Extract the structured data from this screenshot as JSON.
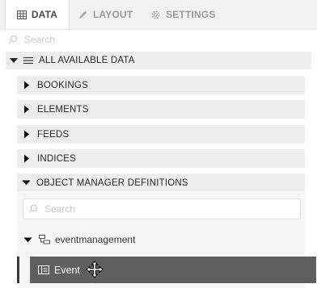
{
  "tabs": [
    {
      "label": "DATA",
      "icon": "table-icon",
      "active": true
    },
    {
      "label": "LAYOUT",
      "icon": "pencil-icon",
      "active": false
    },
    {
      "label": "SETTINGS",
      "icon": "gear-icon",
      "active": false
    }
  ],
  "search": {
    "placeholder": "Search"
  },
  "tree": {
    "root_label": "ALL AVAILABLE DATA",
    "categories": [
      {
        "label": "BOOKINGS",
        "expanded": false
      },
      {
        "label": "ELEMENTS",
        "expanded": false
      },
      {
        "label": "FEEDS",
        "expanded": false
      },
      {
        "label": "INDICES",
        "expanded": false
      },
      {
        "label": "OBJECT MANAGER DEFINITIONS",
        "expanded": true
      }
    ],
    "inner_search_placeholder": "Search",
    "node_label": "eventmanagement",
    "leaf_label": "Event"
  },
  "colors": {
    "selected_leaf_bg": "#5f5f5f",
    "row_bg": "#eeeeee",
    "tabbar_bg": "#f2f2f2"
  }
}
